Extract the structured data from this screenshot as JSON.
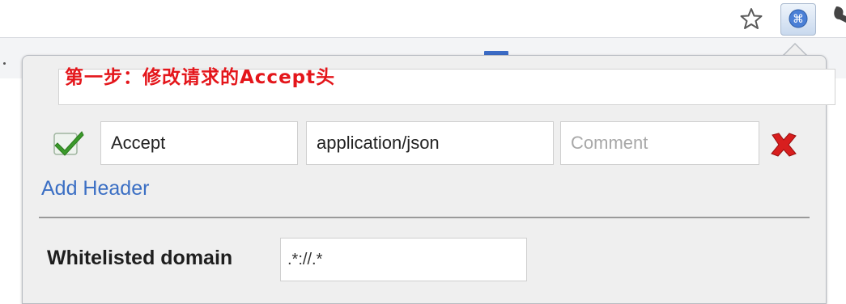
{
  "annotation": {
    "text": "第一步：修改请求的Accept头"
  },
  "header_row": {
    "enabled": true,
    "name_value": "Accept",
    "value_value": "application/json",
    "comment_placeholder": "Comment"
  },
  "add_header_label": "Add Header",
  "whitelist": {
    "label": "Whitelisted domain",
    "value": ".*://.*"
  },
  "colors": {
    "annotation": "#e4161b",
    "link": "#3b6fc4",
    "delete": "#d81e1e",
    "check": "#3a9a2a"
  }
}
